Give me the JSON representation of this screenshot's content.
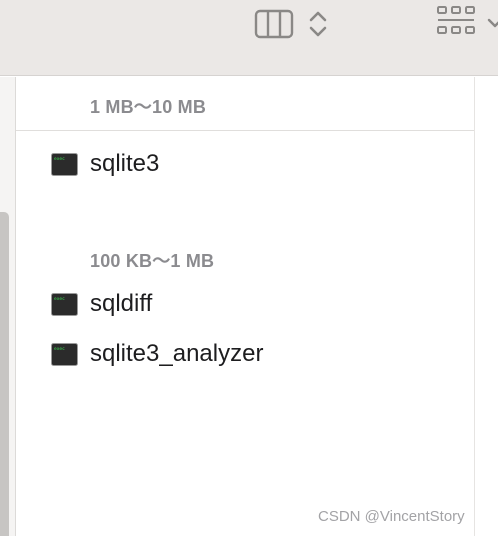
{
  "toolbar": {
    "icons": [
      "column-view-icon",
      "up-down-chevron-icon",
      "grid-view-icon",
      "chevron-down-icon"
    ]
  },
  "groups": [
    {
      "header": "1 MB～10 MB",
      "files": [
        {
          "name": "sqlite3",
          "icon": "exec-icon",
          "icon_label": "exec"
        }
      ]
    },
    {
      "header": "100 KB～1 MB",
      "files": [
        {
          "name": "sqldiff",
          "icon": "exec-icon",
          "icon_label": "exec"
        },
        {
          "name": "sqlite3_analyzer",
          "icon": "exec-icon",
          "icon_label": "exec"
        }
      ]
    }
  ],
  "watermark": "CSDN @VincentStory",
  "colors": {
    "toolbar_bg": "#ebe8e6",
    "group_header": "#8b8b8f",
    "exec_icon_bg": "#2b2b2b",
    "exec_icon_text": "#3ddc54"
  }
}
